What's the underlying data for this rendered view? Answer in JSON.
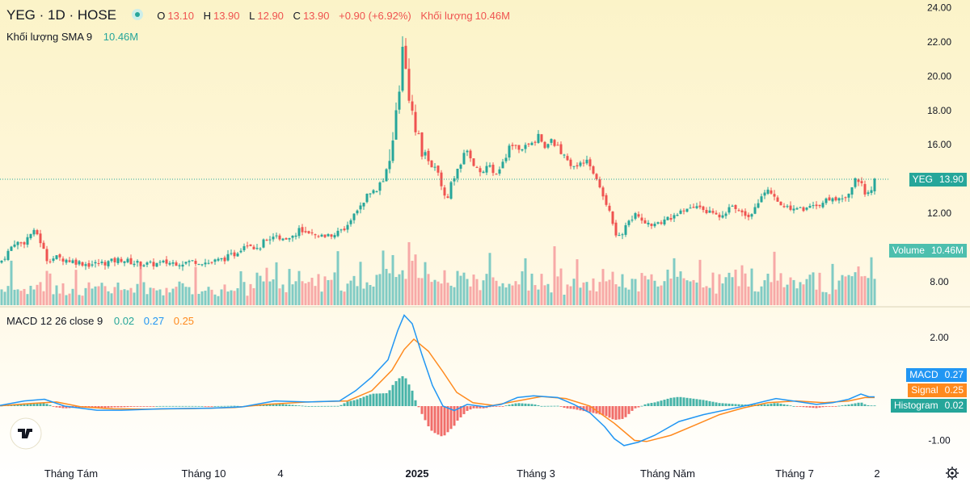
{
  "header": {
    "symbol": "YEG · 1D · HOSE",
    "open_label": "O",
    "open": "13.10",
    "high_label": "H",
    "high": "13.90",
    "low_label": "L",
    "low": "12.90",
    "close_label": "C",
    "close": "13.90",
    "change": "+0.90 (+6.92%)",
    "volume_label": "Khối lượng",
    "volume": "10.46M",
    "sma_label": "Khối lượng SMA 9",
    "sma_value": "10.46M"
  },
  "macd_legend": {
    "label": "MACD 12 26 close 9",
    "hist": "0.02",
    "macd": "0.27",
    "signal": "0.25"
  },
  "price_tags": {
    "yeg_label": "YEG",
    "yeg_value": "13.90",
    "volume_label": "Volume",
    "volume_value": "10.46M",
    "macd_label": "MACD",
    "macd_value": "0.27",
    "signal_label": "Signal",
    "signal_value": "0.25",
    "hist_label": "Histogram",
    "hist_value": "0.02"
  },
  "colors": {
    "up": "#26a69a",
    "down": "#ef5350",
    "up_vol": "#80cbc4",
    "down_vol": "#f7a9a7",
    "macd": "#2196f3",
    "signal": "#ff8a1e",
    "tag_price": "#26a69a",
    "tag_vol": "#4dbfae",
    "tag_macd": "#2196f3",
    "tag_signal": "#ff8a1e",
    "tag_hist": "#26a69a"
  },
  "chart_data": {
    "type": "candlestick",
    "symbol": "YEG",
    "interval": "1D",
    "exchange": "HOSE",
    "price_axis": {
      "ticks": [
        "24.00",
        "22.00",
        "20.00",
        "18.00",
        "16.00",
        "12.00",
        "8.00"
      ],
      "range": [
        6.6,
        24.0
      ]
    },
    "macd_axis": {
      "ticks": [
        "2.00",
        "-1.00"
      ],
      "range": [
        -1.45,
        2.9
      ]
    },
    "time_axis": [
      "Tháng Tám",
      "Tháng 10",
      "4",
      "2025",
      "Tháng 3",
      "Tháng Năm",
      "Tháng 7",
      "2"
    ],
    "close_path": [
      [
        0,
        9.1
      ],
      [
        8,
        9.6
      ],
      [
        18,
        10.3
      ],
      [
        28,
        10.2
      ],
      [
        38,
        10.8
      ],
      [
        45,
        10.9
      ],
      [
        52,
        10.1
      ],
      [
        58,
        9.3
      ],
      [
        70,
        9.4
      ],
      [
        90,
        9.2
      ],
      [
        110,
        9.0
      ],
      [
        130,
        9.1
      ],
      [
        150,
        9.3
      ],
      [
        165,
        9.1
      ],
      [
        185,
        9.0
      ],
      [
        205,
        9.1
      ],
      [
        225,
        9.1
      ],
      [
        240,
        9.2
      ],
      [
        258,
        9.1
      ],
      [
        275,
        9.3
      ],
      [
        290,
        9.6
      ],
      [
        305,
        10.3
      ],
      [
        318,
        9.9
      ],
      [
        330,
        10.5
      ],
      [
        345,
        10.6
      ],
      [
        360,
        10.6
      ],
      [
        370,
        11.0
      ],
      [
        380,
        10.8
      ],
      [
        392,
        10.6
      ],
      [
        405,
        10.7
      ],
      [
        418,
        10.9
      ],
      [
        428,
        11.1
      ],
      [
        438,
        11.9
      ],
      [
        448,
        12.6
      ],
      [
        456,
        13.1
      ],
      [
        466,
        13.4
      ],
      [
        474,
        14.2
      ],
      [
        482,
        15.2
      ],
      [
        490,
        17.9
      ],
      [
        496,
        20.2
      ],
      [
        500,
        22.5
      ],
      [
        504,
        18.5
      ],
      [
        512,
        17.5
      ],
      [
        520,
        15.9
      ],
      [
        528,
        15.2
      ],
      [
        536,
        14.8
      ],
      [
        545,
        13.6
      ],
      [
        553,
        12.8
      ],
      [
        561,
        13.8
      ],
      [
        569,
        14.8
      ],
      [
        577,
        15.8
      ],
      [
        585,
        14.9
      ],
      [
        595,
        14.4
      ],
      [
        603,
        14.8
      ],
      [
        612,
        14.3
      ],
      [
        622,
        14.9
      ],
      [
        632,
        16.0
      ],
      [
        640,
        15.8
      ],
      [
        650,
        15.9
      ],
      [
        658,
        16.0
      ],
      [
        666,
        16.6
      ],
      [
        674,
        15.8
      ],
      [
        682,
        16.2
      ],
      [
        690,
        15.9
      ],
      [
        698,
        15.3
      ],
      [
        706,
        14.6
      ],
      [
        714,
        14.9
      ],
      [
        722,
        15.1
      ],
      [
        730,
        14.8
      ],
      [
        738,
        13.9
      ],
      [
        746,
        13.0
      ],
      [
        754,
        12.2
      ],
      [
        762,
        10.8
      ],
      [
        770,
        10.8
      ],
      [
        778,
        11.6
      ],
      [
        786,
        11.9
      ],
      [
        796,
        11.6
      ],
      [
        806,
        11.2
      ],
      [
        816,
        11.4
      ],
      [
        826,
        11.7
      ],
      [
        836,
        11.9
      ],
      [
        846,
        12.1
      ],
      [
        856,
        12.3
      ],
      [
        866,
        12.4
      ],
      [
        876,
        12.1
      ],
      [
        886,
        11.8
      ],
      [
        896,
        12.1
      ],
      [
        906,
        12.3
      ],
      [
        916,
        12.2
      ],
      [
        926,
        11.9
      ],
      [
        936,
        12.4
      ],
      [
        944,
        13.3
      ],
      [
        952,
        13.2
      ],
      [
        962,
        12.6
      ],
      [
        972,
        12.4
      ],
      [
        982,
        12.3
      ],
      [
        992,
        12.2
      ],
      [
        1002,
        12.4
      ],
      [
        1012,
        12.5
      ],
      [
        1022,
        12.7
      ],
      [
        1032,
        12.8
      ],
      [
        1042,
        12.9
      ],
      [
        1050,
        13.1
      ],
      [
        1058,
        14.0
      ],
      [
        1066,
        13.8
      ],
      [
        1072,
        13.0
      ],
      [
        1078,
        13.3
      ],
      [
        1082,
        13.9
      ]
    ],
    "volume_series": {
      "name": "Volume",
      "last": "10.46M"
    },
    "macd_path": [
      [
        0,
        0.02
      ],
      [
        30,
        0.15
      ],
      [
        55,
        0.2
      ],
      [
        80,
        0.0
      ],
      [
        120,
        -0.12
      ],
      [
        150,
        -0.12
      ],
      [
        200,
        -0.08
      ],
      [
        260,
        -0.06
      ],
      [
        300,
        -0.02
      ],
      [
        340,
        0.15
      ],
      [
        380,
        0.12
      ],
      [
        420,
        0.15
      ],
      [
        440,
        0.45
      ],
      [
        460,
        0.85
      ],
      [
        480,
        1.35
      ],
      [
        492,
        2.2
      ],
      [
        500,
        2.65
      ],
      [
        510,
        2.4
      ],
      [
        522,
        1.5
      ],
      [
        535,
        0.6
      ],
      [
        548,
        0.0
      ],
      [
        562,
        -0.13
      ],
      [
        578,
        0.05
      ],
      [
        600,
        -0.02
      ],
      [
        620,
        0.05
      ],
      [
        640,
        0.25
      ],
      [
        660,
        0.3
      ],
      [
        690,
        0.25
      ],
      [
        710,
        0.05
      ],
      [
        730,
        -0.2
      ],
      [
        748,
        -0.6
      ],
      [
        760,
        -0.95
      ],
      [
        772,
        -1.15
      ],
      [
        790,
        -1.05
      ],
      [
        810,
        -0.85
      ],
      [
        840,
        -0.45
      ],
      [
        870,
        -0.25
      ],
      [
        900,
        -0.1
      ],
      [
        930,
        0.05
      ],
      [
        960,
        0.22
      ],
      [
        990,
        0.12
      ],
      [
        1010,
        0.05
      ],
      [
        1030,
        0.1
      ],
      [
        1050,
        0.2
      ],
      [
        1065,
        0.35
      ],
      [
        1075,
        0.27
      ],
      [
        1082,
        0.27
      ]
    ],
    "signal_path": [
      [
        0,
        0.01
      ],
      [
        40,
        0.08
      ],
      [
        70,
        0.12
      ],
      [
        100,
        -0.02
      ],
      [
        140,
        -0.08
      ],
      [
        180,
        -0.09
      ],
      [
        240,
        -0.07
      ],
      [
        290,
        -0.04
      ],
      [
        330,
        0.05
      ],
      [
        380,
        0.12
      ],
      [
        430,
        0.15
      ],
      [
        460,
        0.45
      ],
      [
        485,
        1.05
      ],
      [
        500,
        1.65
      ],
      [
        512,
        1.95
      ],
      [
        530,
        1.6
      ],
      [
        548,
        1.0
      ],
      [
        565,
        0.4
      ],
      [
        585,
        0.1
      ],
      [
        610,
        0.02
      ],
      [
        640,
        0.15
      ],
      [
        670,
        0.28
      ],
      [
        700,
        0.22
      ],
      [
        730,
        0.0
      ],
      [
        760,
        -0.5
      ],
      [
        785,
        -1.0
      ],
      [
        800,
        -1.03
      ],
      [
        830,
        -0.85
      ],
      [
        860,
        -0.55
      ],
      [
        890,
        -0.25
      ],
      [
        920,
        -0.05
      ],
      [
        950,
        0.1
      ],
      [
        985,
        0.15
      ],
      [
        1020,
        0.1
      ],
      [
        1050,
        0.15
      ],
      [
        1070,
        0.25
      ],
      [
        1082,
        0.25
      ]
    ]
  }
}
